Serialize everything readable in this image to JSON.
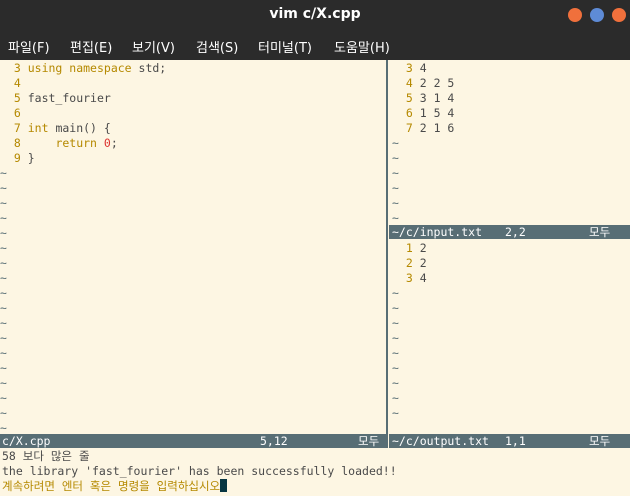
{
  "window": {
    "title": "vim c/X.cpp",
    "buttons": {
      "minimize_color": "#f0703c",
      "maximize_color": "#5e8bd6",
      "close_color": "#f0703c"
    }
  },
  "menu": [
    "파일(F)",
    "편집(E)",
    "보기(V)",
    "검색(S)",
    "터미널(T)",
    "도움말(H)"
  ],
  "left_pane": {
    "lines": [
      {
        "num": "3",
        "parts": [
          {
            "t": "using ",
            "c": "kw"
          },
          {
            "t": "namespace",
            "c": "kw"
          },
          {
            "t": " std;",
            "c": ""
          }
        ]
      },
      {
        "num": "4",
        "parts": []
      },
      {
        "num": "5",
        "parts": [
          {
            "t": "fast_fourier",
            "c": ""
          }
        ]
      },
      {
        "num": "6",
        "parts": []
      },
      {
        "num": "7",
        "parts": [
          {
            "t": "int",
            "c": "kw"
          },
          {
            "t": " main() {",
            "c": ""
          }
        ]
      },
      {
        "num": "8",
        "parts": [
          {
            "t": "    ",
            "c": ""
          },
          {
            "t": "return",
            "c": "kw"
          },
          {
            "t": " ",
            "c": ""
          },
          {
            "t": "0",
            "c": "num"
          },
          {
            "t": ";",
            "c": ""
          }
        ]
      },
      {
        "num": "9",
        "parts": [
          {
            "t": "}",
            "c": ""
          }
        ]
      }
    ],
    "tildes": 18,
    "status": {
      "file": "c/X.cpp",
      "pos": "5,12",
      "scroll": "모두"
    }
  },
  "input_pane": {
    "lines": [
      {
        "num": "3",
        "text": "4"
      },
      {
        "num": "4",
        "text": "2 2 5"
      },
      {
        "num": "5",
        "text": "3 1 4"
      },
      {
        "num": "6",
        "text": "1 5 4"
      },
      {
        "num": "7",
        "text": "2 1 6"
      }
    ],
    "tildes": 6,
    "status": {
      "file": "~/c/input.txt",
      "pos": "2,2",
      "scroll": "모두"
    }
  },
  "output_pane": {
    "lines": [
      {
        "num": "1",
        "text": "2"
      },
      {
        "num": "2",
        "text": "2"
      },
      {
        "num": "3",
        "text": "4"
      }
    ],
    "tildes": 9,
    "status": {
      "file": "~/c/output.txt",
      "pos": "1,1",
      "scroll": "모두"
    }
  },
  "messages": {
    "line1": "58 보다 많은 줄",
    "line2": "the library 'fast_fourier' has been successfully loaded!!",
    "prompt": "계속하려면 엔터 혹은 명령을 입력하십시오"
  }
}
